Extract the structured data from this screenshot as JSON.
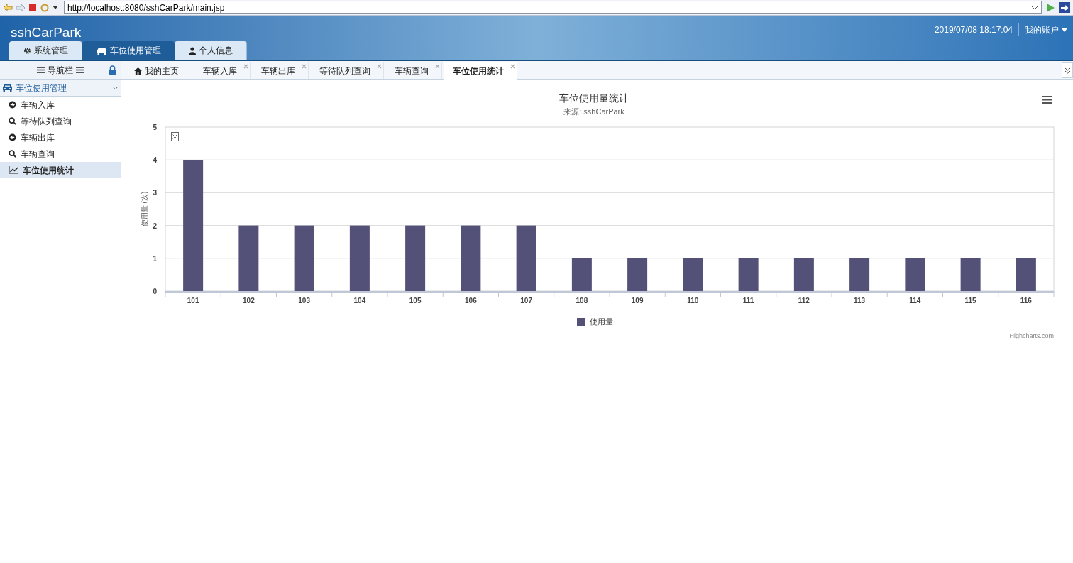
{
  "browser": {
    "url": "http://localhost:8080/sshCarPark/main.jsp"
  },
  "header": {
    "app_title": "sshCarPark",
    "datetime": "2019/07/08 18:17:04",
    "account_menu": "我的账户"
  },
  "top_tabs": [
    {
      "label": "系统管理",
      "selected": false
    },
    {
      "label": "车位使用管理",
      "selected": true
    },
    {
      "label": "个人信息",
      "selected": false
    }
  ],
  "sidebar": {
    "title": "导航栏",
    "group": {
      "label": "车位使用管理",
      "expanded": true,
      "items": [
        {
          "label": "车辆入库",
          "selected": false
        },
        {
          "label": "等待队列查询",
          "selected": false
        },
        {
          "label": "车辆出库",
          "selected": false
        },
        {
          "label": "车辆查询",
          "selected": false
        },
        {
          "label": "车位使用统计",
          "selected": true
        }
      ]
    }
  },
  "content_tabs": [
    {
      "label": "我的主页",
      "selected": false,
      "closable": false
    },
    {
      "label": "车辆入库",
      "selected": false,
      "closable": true
    },
    {
      "label": "车辆出库",
      "selected": false,
      "closable": true
    },
    {
      "label": "等待队列查询",
      "selected": false,
      "closable": true
    },
    {
      "label": "车辆查询",
      "selected": false,
      "closable": true
    },
    {
      "label": "车位使用统计",
      "selected": true,
      "closable": true
    }
  ],
  "chart": {
    "credits": "Highcharts.com",
    "chart_data": {
      "type": "bar",
      "grid": true,
      "title": "车位使用量统计",
      "subtitle": "来源: sshCarPark",
      "ylabel": "使用量 (次)",
      "categories": [
        "101",
        "102",
        "103",
        "104",
        "105",
        "106",
        "107",
        "108",
        "109",
        "110",
        "111",
        "112",
        "113",
        "114",
        "115",
        "116"
      ],
      "series": [
        {
          "name": "使用量",
          "color": "#535178",
          "values": [
            4,
            2,
            2,
            2,
            2,
            2,
            2,
            1,
            1,
            1,
            1,
            1,
            1,
            1,
            1,
            1
          ]
        }
      ],
      "ylim": [
        0,
        5
      ],
      "yticks": [
        0,
        1,
        2,
        3,
        4,
        5
      ]
    }
  }
}
